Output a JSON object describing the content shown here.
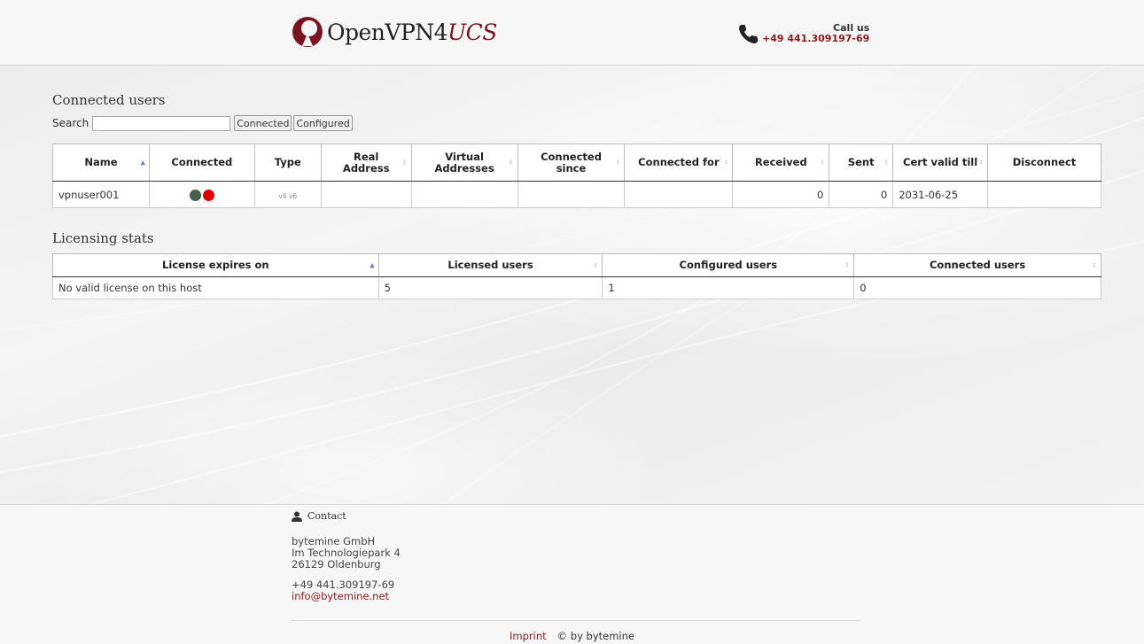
{
  "header": {
    "logo_text_main": "OpenVPN4",
    "logo_text_accent": "UCS",
    "call_label": "Call us",
    "phone": "+49 441.309197-69"
  },
  "connected_users": {
    "heading": "Connected users",
    "search_label": "Search",
    "search_value": "",
    "filter_buttons": [
      "Connected",
      "Configured"
    ],
    "columns": [
      "Name",
      "Connected",
      "Type",
      "Real Address",
      "Virtual Addresses",
      "Connected since",
      "Connected for",
      "Received",
      "Sent",
      "Cert valid till",
      "Disconnect"
    ],
    "rows": [
      {
        "name": "vpnuser001",
        "connected_indicators": [
          "gray-green",
          "red"
        ],
        "type": "v4 v6",
        "real_address": "",
        "virtual_addresses": "",
        "connected_since": "",
        "connected_for": "",
        "received": "0",
        "sent": "0",
        "cert_valid_till": "2031-06-25",
        "disconnect": ""
      }
    ]
  },
  "licensing": {
    "heading": "Licensing stats",
    "columns": [
      "License expires on",
      "Licensed users",
      "Configured users",
      "Connected users"
    ],
    "row": {
      "expires": "No valid license on this host",
      "licensed": "5",
      "configured": "1",
      "connected": "0"
    }
  },
  "footer": {
    "contact_title": "Contact",
    "company": "bytemine GmbH",
    "street": "Im Technologiepark 4",
    "city": "26129 Oldenburg",
    "phone": "+49 441.309197-69",
    "email": "info@bytemine.net",
    "imprint": "Imprint",
    "copyright": "© by bytemine"
  },
  "colors": {
    "brand": "#7a1420",
    "link": "#8b1a1a",
    "dot_connected": "#4a5f4a",
    "dot_disconnected": "#e00000",
    "sort_active": "#6a7fd0"
  }
}
